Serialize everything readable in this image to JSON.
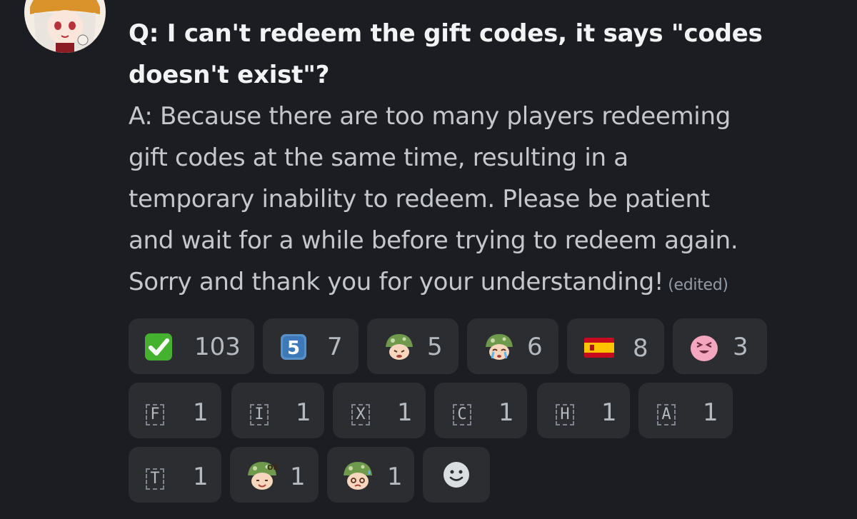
{
  "message": {
    "question": "Q: I can't redeem the gift codes, it says \"codes doesn't exist\"?",
    "answer_lines": [
      "A: Because there are too many players redeeming",
      "gift codes at the same time, resulting in a",
      "temporary inability to redeem. Please be patient",
      "and wait for a while before trying to redeem again.",
      "Sorry and thank you for your understanding!"
    ],
    "edited_label": "(edited)"
  },
  "reactions": [
    {
      "emoji": "white-check-mark",
      "count": "103"
    },
    {
      "emoji": "keycap-5",
      "glyph": "5",
      "count": "7"
    },
    {
      "emoji": "mushroom-sad",
      "count": "5"
    },
    {
      "emoji": "mushroom-cry",
      "count": "6"
    },
    {
      "emoji": "flag-spain",
      "count": "8"
    },
    {
      "emoji": "pink-blob-laugh",
      "count": "3"
    },
    {
      "emoji": "regional-f",
      "glyph": "F",
      "count": "1"
    },
    {
      "emoji": "regional-i",
      "glyph": "I",
      "count": "1"
    },
    {
      "emoji": "regional-x",
      "glyph": "X",
      "count": "1"
    },
    {
      "emoji": "regional-c",
      "glyph": "C",
      "count": "1"
    },
    {
      "emoji": "regional-h",
      "glyph": "H",
      "count": "1"
    },
    {
      "emoji": "regional-a",
      "glyph": "A",
      "count": "1"
    },
    {
      "emoji": "regional-t",
      "glyph": "T",
      "count": "1"
    },
    {
      "emoji": "mushroom-ok",
      "count": "1"
    },
    {
      "emoji": "mushroom-sweat",
      "count": "1"
    }
  ],
  "add_reaction": {
    "icon": "smiley-add-icon"
  },
  "colors": {
    "background": "#1c1d22",
    "pill": "#2b2d31",
    "text": "#c4c7cc",
    "bold": "#f2f3f5"
  }
}
